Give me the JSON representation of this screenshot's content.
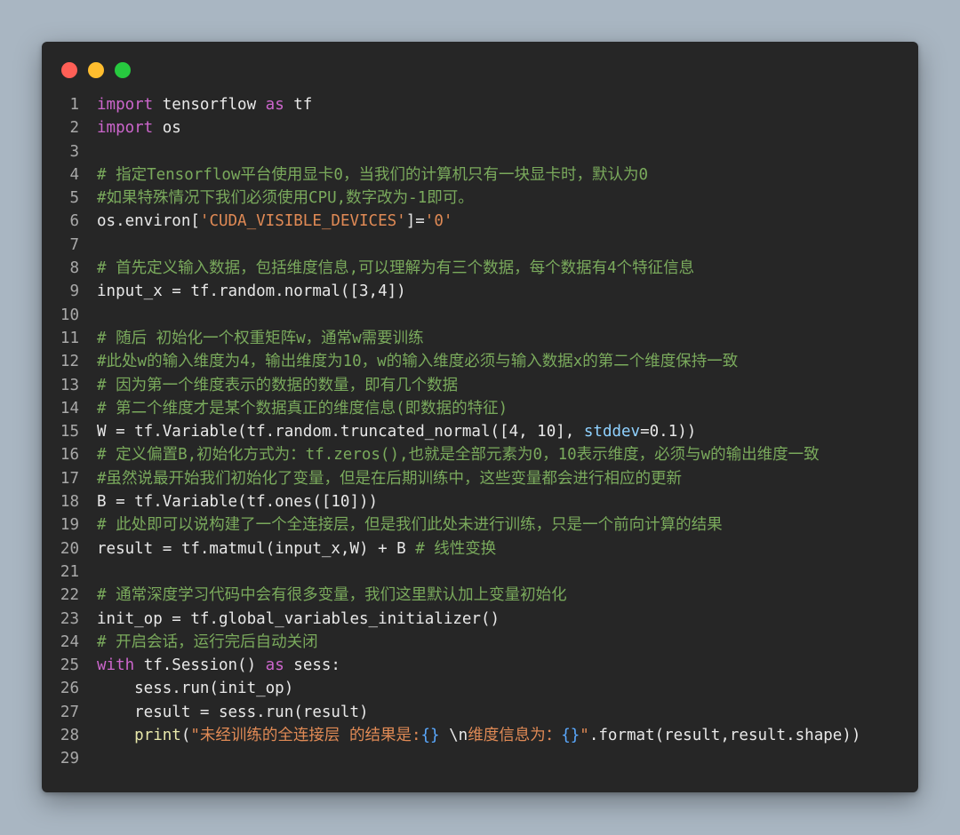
{
  "window": {
    "traffic_lights": [
      {
        "name": "close",
        "color": "#ff5f56"
      },
      {
        "name": "minimize",
        "color": "#ffbd2e"
      },
      {
        "name": "maximize",
        "color": "#27c93f"
      }
    ]
  },
  "code": {
    "lines": [
      {
        "n": "1",
        "t": [
          {
            "k": "kw",
            "v": "import"
          },
          {
            "k": "",
            "v": " tensorflow "
          },
          {
            "k": "kw",
            "v": "as"
          },
          {
            "k": "",
            "v": " tf"
          }
        ]
      },
      {
        "n": "2",
        "t": [
          {
            "k": "kw",
            "v": "import"
          },
          {
            "k": "",
            "v": " os"
          }
        ]
      },
      {
        "n": "3",
        "t": []
      },
      {
        "n": "4",
        "t": [
          {
            "k": "cm",
            "v": "# 指定Tensorflow平台使用显卡0，当我们的计算机只有一块显卡时，默认为0"
          }
        ]
      },
      {
        "n": "5",
        "t": [
          {
            "k": "cm",
            "v": "#如果特殊情况下我们必须使用CPU,数字改为-1即可。"
          }
        ]
      },
      {
        "n": "6",
        "t": [
          {
            "k": "",
            "v": "os.environ["
          },
          {
            "k": "str",
            "v": "'CUDA_VISIBLE_DEVICES'"
          },
          {
            "k": "",
            "v": "]="
          },
          {
            "k": "str",
            "v": "'0'"
          }
        ]
      },
      {
        "n": "7",
        "t": []
      },
      {
        "n": "8",
        "t": [
          {
            "k": "cm",
            "v": "# 首先定义输入数据，包括维度信息,可以理解为有三个数据，每个数据有4个特征信息"
          }
        ]
      },
      {
        "n": "9",
        "t": [
          {
            "k": "",
            "v": "input_x = tf.random.normal([3,4])"
          }
        ]
      },
      {
        "n": "10",
        "t": []
      },
      {
        "n": "11",
        "t": [
          {
            "k": "cm",
            "v": "# 随后 初始化一个权重矩阵w，通常w需要训练"
          }
        ]
      },
      {
        "n": "12",
        "t": [
          {
            "k": "cm",
            "v": "#此处w的输入维度为4，输出维度为10，w的输入维度必须与输入数据x的第二个维度保持一致"
          }
        ]
      },
      {
        "n": "13",
        "t": [
          {
            "k": "cm",
            "v": "# 因为第一个维度表示的数据的数量，即有几个数据"
          }
        ]
      },
      {
        "n": "14",
        "t": [
          {
            "k": "cm",
            "v": "# 第二个维度才是某个数据真正的维度信息(即数据的特征)"
          }
        ]
      },
      {
        "n": "15",
        "t": [
          {
            "k": "",
            "v": "W = tf.Variable(tf.random.truncated_normal([4, 10], "
          },
          {
            "k": "param",
            "v": "stddev"
          },
          {
            "k": "",
            "v": "=0.1))"
          }
        ]
      },
      {
        "n": "16",
        "t": [
          {
            "k": "cm",
            "v": "# 定义偏置B,初始化方式为：tf.zeros(),也就是全部元素为0，10表示维度，必须与w的输出维度一致"
          }
        ]
      },
      {
        "n": "17",
        "t": [
          {
            "k": "cm",
            "v": "#虽然说最开始我们初始化了变量，但是在后期训练中，这些变量都会进行相应的更新"
          }
        ]
      },
      {
        "n": "18",
        "t": [
          {
            "k": "",
            "v": "B = tf.Variable(tf.ones([10]))"
          }
        ]
      },
      {
        "n": "19",
        "t": [
          {
            "k": "cm",
            "v": "# 此处即可以说构建了一个全连接层，但是我们此处未进行训练，只是一个前向计算的结果"
          }
        ]
      },
      {
        "n": "20",
        "t": [
          {
            "k": "",
            "v": "result = tf.matmul(input_x,W) + B "
          },
          {
            "k": "cm",
            "v": "# 线性变换"
          }
        ]
      },
      {
        "n": "21",
        "t": []
      },
      {
        "n": "22",
        "t": [
          {
            "k": "cm",
            "v": "# 通常深度学习代码中会有很多变量，我们这里默认加上变量初始化"
          }
        ]
      },
      {
        "n": "23",
        "t": [
          {
            "k": "",
            "v": "init_op = tf.global_variables_initializer()"
          }
        ]
      },
      {
        "n": "24",
        "t": [
          {
            "k": "cm",
            "v": "# 开启会话，运行完后自动关闭"
          }
        ]
      },
      {
        "n": "25",
        "t": [
          {
            "k": "kw",
            "v": "with"
          },
          {
            "k": "",
            "v": " tf.Session() "
          },
          {
            "k": "kw",
            "v": "as"
          },
          {
            "k": "",
            "v": " sess:"
          }
        ]
      },
      {
        "n": "26",
        "t": [
          {
            "k": "",
            "v": "    sess.run(init_op)"
          }
        ]
      },
      {
        "n": "27",
        "t": [
          {
            "k": "",
            "v": "    result = sess.run(result)"
          }
        ]
      },
      {
        "n": "28",
        "t": [
          {
            "k": "",
            "v": "    "
          },
          {
            "k": "fn",
            "v": "print"
          },
          {
            "k": "",
            "v": "("
          },
          {
            "k": "str",
            "v": "\"未经训练的全连接层 的结果是:"
          },
          {
            "k": "brace",
            "v": "{}"
          },
          {
            "k": "str",
            "v": " "
          },
          {
            "k": "esc",
            "v": "\\n"
          },
          {
            "k": "str",
            "v": "维度信息为："
          },
          {
            "k": "brace",
            "v": "{}"
          },
          {
            "k": "str",
            "v": "\""
          },
          {
            "k": "",
            "v": ".format(result,result.shape))"
          }
        ]
      },
      {
        "n": "29",
        "t": []
      }
    ]
  }
}
